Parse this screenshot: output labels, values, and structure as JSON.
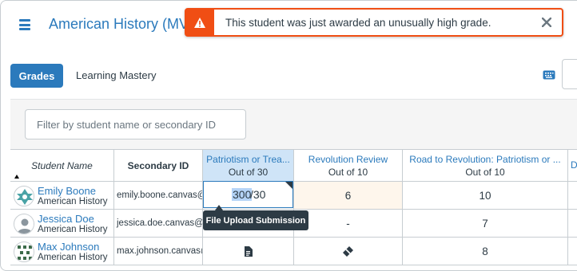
{
  "header": {
    "course_title": "American History (MV",
    "menu_icon": "hamburger-icon"
  },
  "alert": {
    "message": "This student was just awarded an unusually high grade.",
    "icon": "warning-icon",
    "close_icon": "close-icon",
    "color": "#f04e14"
  },
  "tabs": {
    "grades": "Grades",
    "learning_mastery": "Learning Mastery"
  },
  "filter": {
    "placeholder": "Filter by student name or secondary ID"
  },
  "columns": {
    "student_name": "Student Name",
    "secondary_id": "Secondary ID",
    "assignments": [
      {
        "title": "Patriotism or Trea...",
        "points": "Out of 30"
      },
      {
        "title": "Revolution Review",
        "points": "Out of 10"
      },
      {
        "title": "Road to Revolution: Patriotism or ...",
        "points": "Out of 10"
      },
      {
        "title": "D",
        "points": ""
      }
    ]
  },
  "students": [
    {
      "name": "Emily Boone",
      "section": "American History",
      "secondary_id": "emily.boone.canvas@",
      "scores": [
        "300",
        "6",
        "10"
      ]
    },
    {
      "name": "Jessica Doe",
      "section": "American History",
      "secondary_id": "jessica.doe.canvas@g",
      "scores": [
        "",
        "-",
        "7"
      ]
    },
    {
      "name": "Max Johnson",
      "section": "American History",
      "secondary_id": "max.johnson.canvas@",
      "scores": [
        "document-icon",
        "eraser-icon",
        "8"
      ]
    }
  ],
  "editing": {
    "value": "300",
    "out_of": "/30"
  },
  "tooltip": "File Upload Submission",
  "colors": {
    "brand": "#2b7abc",
    "active_header": "#cfe4f7",
    "highlight_cell": "#fef6ec",
    "alert": "#f04e14"
  }
}
